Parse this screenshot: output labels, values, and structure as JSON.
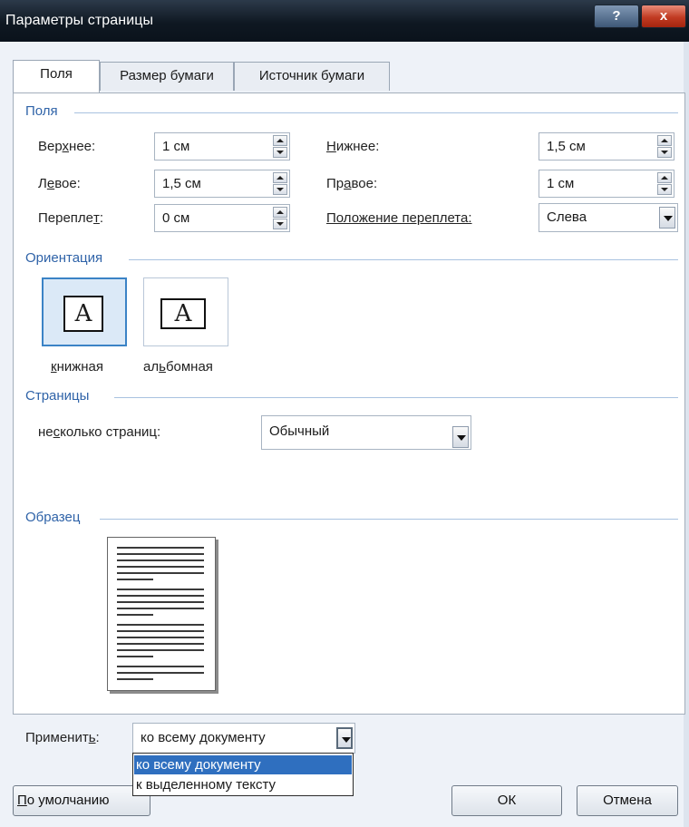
{
  "window": {
    "title": "Параметры страницы",
    "help_label": "?",
    "close_label": "x"
  },
  "tabs": [
    {
      "label": "Поля",
      "active": true
    },
    {
      "label": "Размер бумаги",
      "active": false
    },
    {
      "label": "Источник бумаги",
      "active": false
    }
  ],
  "margins": {
    "section_title": "Поля",
    "top_label_pre": "Вер",
    "top_label_u": "х",
    "top_label_post": "нее:",
    "top_value": "1 см",
    "bottom_label_pre": "",
    "bottom_label_u": "Н",
    "bottom_label_post": "ижнее:",
    "bottom_value": "1,5 см",
    "left_label_pre": "Л",
    "left_label_u": "е",
    "left_label_post": "вое:",
    "left_value": "1,5 см",
    "right_label_pre": "Пр",
    "right_label_u": "а",
    "right_label_post": "вое:",
    "right_value": "1 см",
    "gutter_label_pre": "Переплe",
    "gutter_label_u": "т",
    "gutter_label_post": ":",
    "gutter_value": "0 см",
    "gutter_pos_label": "Положение переплета:",
    "gutter_pos_value": "Слева"
  },
  "orientation": {
    "section_title": "Ориентация",
    "portrait_label_u": "к",
    "portrait_label_post": "нижная",
    "landscape_label_pre": "ал",
    "landscape_label_u": "ь",
    "landscape_label_post": "бомная",
    "glyph": "A",
    "selected": "portrait"
  },
  "pages": {
    "section_title": "Страницы",
    "multiple_label_pre": "не",
    "multiple_label_u": "с",
    "multiple_label_post": "колько страниц:",
    "multiple_value": "Обычный"
  },
  "preview": {
    "section_title": "Образец"
  },
  "apply": {
    "label_pre": "Применит",
    "label_u": "ь",
    "label_post": ":",
    "value": "ко всему документу",
    "options": [
      "ко всему документу",
      "к выделенному тексту"
    ],
    "selected_index": 0
  },
  "footer": {
    "default_button_pre": "",
    "default_button_u": "П",
    "default_button_post": "о умолчанию",
    "ok_label": "ОК",
    "cancel_label": "Отмена"
  }
}
